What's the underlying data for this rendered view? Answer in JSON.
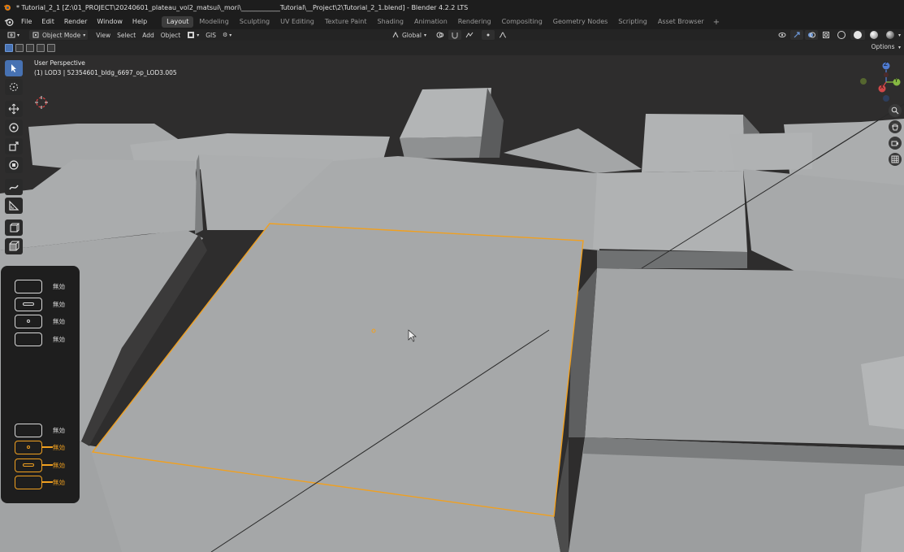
{
  "window": {
    "title": "* Tutorial_2_1 [Z:\\01_PROJECT\\20240601_plateau_vol2_matsui\\_mori\\____________Tutorial\\__Project\\2\\Tutorial_2_1.blend] - Blender 4.2.2 LTS"
  },
  "menu": {
    "items": [
      "File",
      "Edit",
      "Render",
      "Window",
      "Help"
    ]
  },
  "workspaces": {
    "tabs": [
      "Layout",
      "Modeling",
      "Sculpting",
      "UV Editing",
      "Texture Paint",
      "Shading",
      "Animation",
      "Rendering",
      "Compositing",
      "Geometry Nodes",
      "Scripting",
      "Asset Browser"
    ],
    "active": "Layout",
    "add_label": "+"
  },
  "viewport_header": {
    "mode": "Object Mode",
    "view": "View",
    "select": "Select",
    "add": "Add",
    "object": "Object",
    "gis": "GIS",
    "orientation": "Global"
  },
  "options_label": "Options",
  "viewport": {
    "perspective": "User Perspective",
    "active_object": "(1) LOD3 | 52354601_bldg_6697_op_LOD3.005"
  },
  "gizmo": {
    "axis_z": "Z",
    "axis_y": "Y",
    "axis_x": "X"
  },
  "key_panel": {
    "rows": [
      {
        "label": "無効",
        "mark": "none",
        "active": false
      },
      {
        "label": "無効",
        "mark": "bar",
        "active": false
      },
      {
        "label": "無効",
        "mark": "dot",
        "active": false
      },
      {
        "label": "無効",
        "mark": "none",
        "active": false
      },
      {
        "label": "無効",
        "mark": "none",
        "active": false
      },
      {
        "label": "無効",
        "mark": "dot",
        "active": true
      },
      {
        "label": "無効",
        "mark": "bar",
        "active": true
      },
      {
        "label": "無効",
        "mark": "none",
        "active": true
      }
    ]
  },
  "colors": {
    "selection_outline": "#f0a020",
    "accent_blue": "#4772b3",
    "building": "#a9abac",
    "background": "#2d2c2c"
  }
}
